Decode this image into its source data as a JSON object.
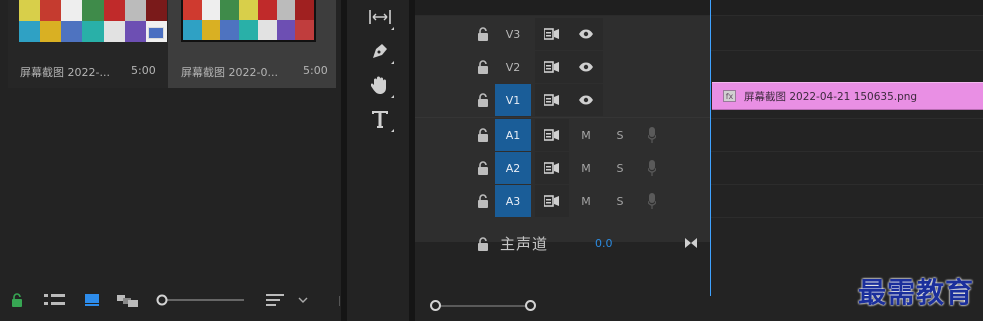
{
  "project": {
    "clips": [
      {
        "name": "屏幕截图 2022-...",
        "duration": "5:00"
      },
      {
        "name": "屏幕截图 2022-0...",
        "duration": "5:00"
      }
    ]
  },
  "timeline": {
    "video_tracks": [
      {
        "label": "V3",
        "targeted": false
      },
      {
        "label": "V2",
        "targeted": false
      },
      {
        "label": "V1",
        "targeted": true
      }
    ],
    "audio_tracks": [
      {
        "label": "A1",
        "mute": "M",
        "solo": "S"
      },
      {
        "label": "A2",
        "mute": "M",
        "solo": "S"
      },
      {
        "label": "A3",
        "mute": "M",
        "solo": "S"
      }
    ],
    "master": {
      "label": "主声道",
      "value": "0.0"
    },
    "clip": {
      "fx": "fx",
      "name": "屏幕截图 2022-04-21 150635.png"
    }
  },
  "colors": {
    "accent": "#1a5d98",
    "playhead": "#3fa2ff",
    "clip": "#e98fe4",
    "lock_green": "#37a653"
  },
  "watermark": "最需教育"
}
